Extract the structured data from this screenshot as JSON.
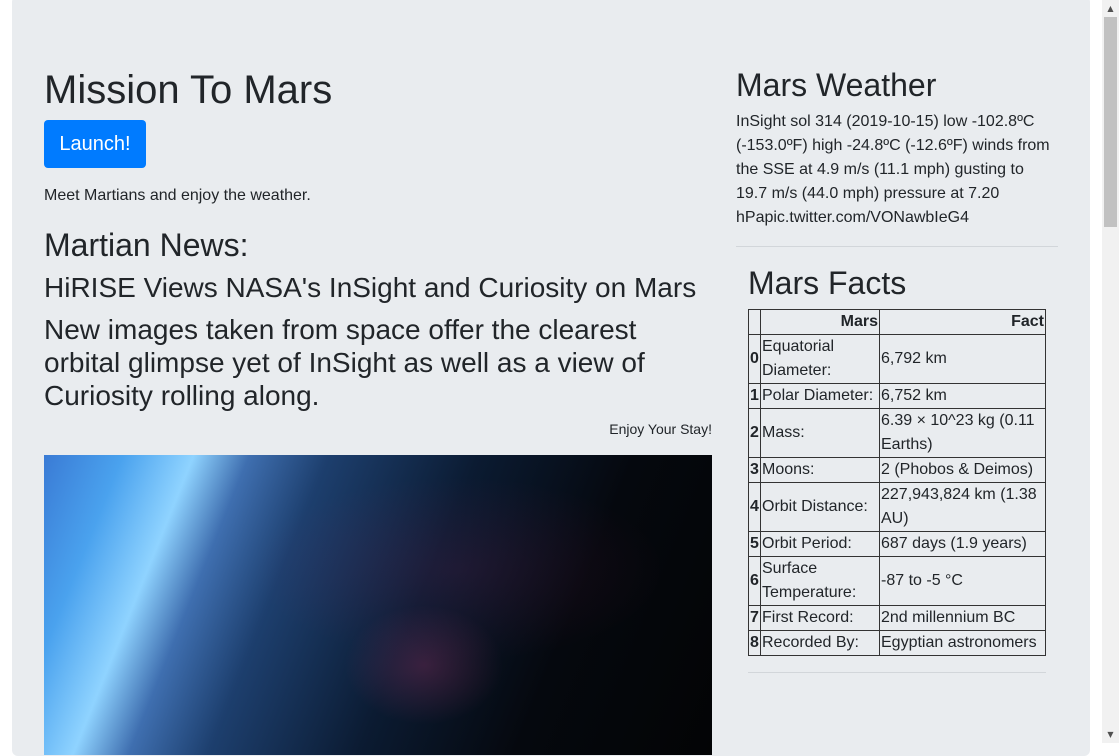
{
  "page": {
    "title": "Mission To Mars",
    "launch_label": "Launch!",
    "tagline": "Meet Martians and enjoy the weather."
  },
  "news": {
    "header": "Martian News:",
    "title": "HiRISE Views NASA's InSight and Curiosity on Mars",
    "teaser": "New images taken from space offer the clearest orbital glimpse yet of InSight as well as a view of Curiosity rolling along.",
    "enjoy": "Enjoy Your Stay!"
  },
  "weather": {
    "header": "Mars Weather",
    "text": "InSight sol 314 (2019-10-15) low -102.8ºC (-153.0ºF) high -24.8ºC (-12.6ºF) winds from the SSE at 4.9 m/s (11.1 mph) gusting to 19.7 m/s (44.0 mph) pressure at 7.20 hPapic.twitter.com/VONawbIeG4"
  },
  "facts": {
    "header": "Mars Facts",
    "columns": [
      "",
      "Mars",
      "Fact"
    ],
    "rows": [
      {
        "index": "0",
        "mars": "Equatorial Diameter:",
        "fact": "6,792 km"
      },
      {
        "index": "1",
        "mars": "Polar Diameter:",
        "fact": "6,752 km"
      },
      {
        "index": "2",
        "mars": "Mass:",
        "fact": "6.39 × 10^23 kg (0.11 Earths)"
      },
      {
        "index": "3",
        "mars": "Moons:",
        "fact": "2 (Phobos & Deimos)"
      },
      {
        "index": "4",
        "mars": "Orbit Distance:",
        "fact": "227,943,824 km (1.38 AU)"
      },
      {
        "index": "5",
        "mars": "Orbit Period:",
        "fact": "687 days (1.9 years)"
      },
      {
        "index": "6",
        "mars": "Surface Temperature:",
        "fact": "-87 to -5 °C"
      },
      {
        "index": "7",
        "mars": "First Record:",
        "fact": "2nd millennium BC"
      },
      {
        "index": "8",
        "mars": "Recorded By:",
        "fact": "Egyptian astronomers"
      }
    ]
  },
  "scrollbar": {
    "up_icon": "▲",
    "down_icon": "▼"
  }
}
